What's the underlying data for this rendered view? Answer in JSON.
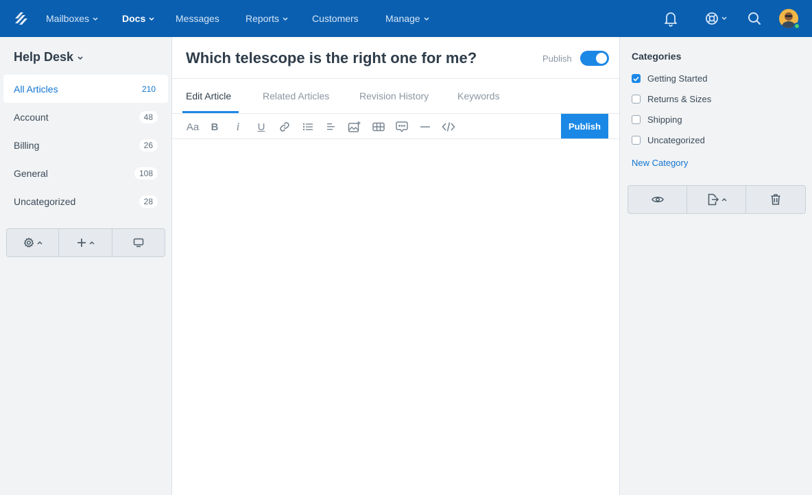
{
  "nav": {
    "items": [
      {
        "label": "Mailboxes",
        "has_caret": true
      },
      {
        "label": "Docs",
        "has_caret": true,
        "active": true
      },
      {
        "label": "Messages",
        "has_caret": false
      },
      {
        "label": "Reports",
        "has_caret": true
      },
      {
        "label": "Customers",
        "has_caret": false
      },
      {
        "label": "Manage",
        "has_caret": true
      }
    ],
    "icons": [
      "notifications-bell-icon",
      "help-lifebuoy-icon",
      "search-icon",
      "user-avatar"
    ],
    "brand_color": "#0a5fb0"
  },
  "sidebar": {
    "title": "Help Desk",
    "items": [
      {
        "label": "All Articles",
        "count": "210",
        "active": true
      },
      {
        "label": "Account",
        "count": "48"
      },
      {
        "label": "Billing",
        "count": "26"
      },
      {
        "label": "General",
        "count": "108"
      },
      {
        "label": "Uncategorized",
        "count": "28"
      }
    ],
    "actions": [
      "settings-gear-icon",
      "add-plus-icon",
      "preview-monitor-icon"
    ]
  },
  "article": {
    "title": "Which telescope is the right one for me?",
    "publish_label": "Publish",
    "publish_toggle_on": true,
    "tabs": [
      {
        "label": "Edit Article",
        "active": true
      },
      {
        "label": "Related Articles"
      },
      {
        "label": "Revision History"
      },
      {
        "label": "Keywords"
      }
    ],
    "toolbar": {
      "font_glyph": "Aa",
      "bold_glyph": "B",
      "italic_glyph": "i",
      "underline_glyph": "U",
      "publish_button": "Publish"
    },
    "accent_color": "#1b88e6"
  },
  "categories": {
    "heading": "Categories",
    "items": [
      {
        "label": "Getting Started",
        "checked": true
      },
      {
        "label": "Returns & Sizes",
        "checked": false
      },
      {
        "label": "Shipping",
        "checked": false
      },
      {
        "label": "Uncategorized",
        "checked": false
      }
    ],
    "new_category": "New Category",
    "actions": [
      "preview-eye-icon",
      "export-icon",
      "delete-trash-icon"
    ]
  }
}
